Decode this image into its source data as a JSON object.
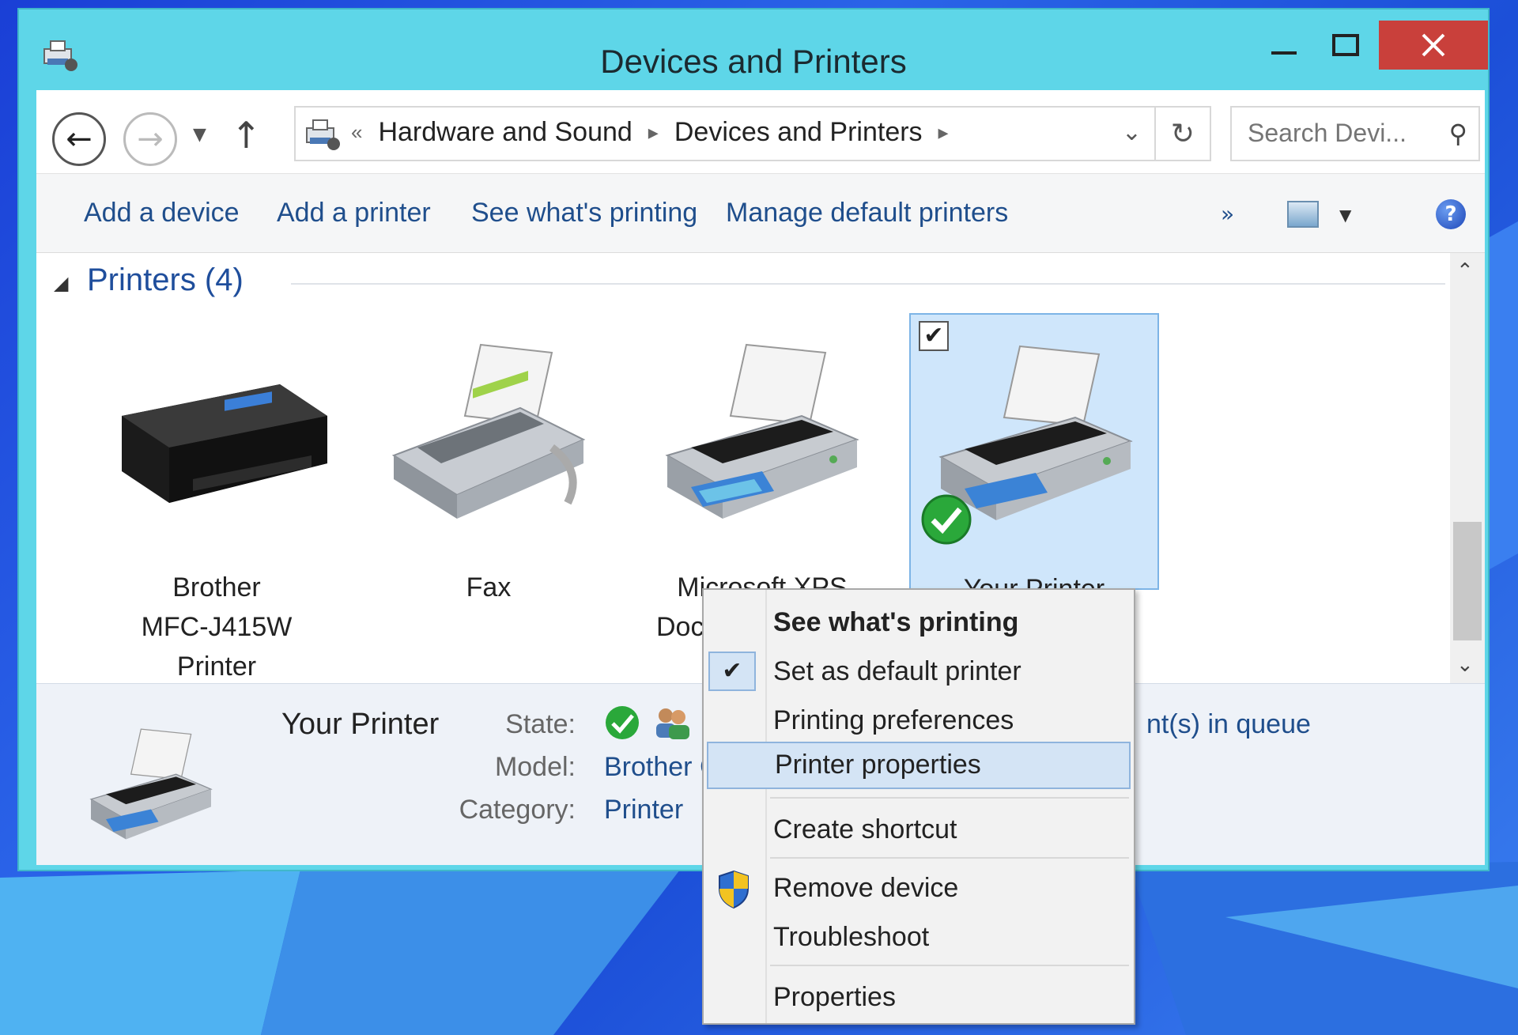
{
  "window": {
    "title": "Devices and Printers"
  },
  "address_bar": {
    "overflow_chevron": "«",
    "crumbs": [
      "Hardware and Sound",
      "Devices and Printers"
    ],
    "search_placeholder": "Search Devi..."
  },
  "command_bar": {
    "add_device": "Add a device",
    "add_printer": "Add a printer",
    "see_printing": "See what's printing",
    "manage_defaults": "Manage default printers",
    "more": "»"
  },
  "group": {
    "label": "Printers (4)"
  },
  "devices": [
    {
      "label_lines": [
        "Brother",
        "MFC-J415W",
        "Printer"
      ],
      "selected": false
    },
    {
      "label_lines": [
        "Fax"
      ],
      "selected": false
    },
    {
      "label_lines": [
        "Microsoft XPS",
        "Docu"
      ],
      "selected": false
    },
    {
      "label_lines": [
        "Your Printer"
      ],
      "selected": true,
      "checked_mark": "✔",
      "default": true
    }
  ],
  "details": {
    "name": "Your Printer",
    "state_label": "State:",
    "model_label": "Model:",
    "category_label": "Category:",
    "model_value": "Brother C",
    "category_value": "Printer",
    "queue_text": "nt(s) in queue"
  },
  "context_menu": {
    "items": [
      {
        "label": "See what's printing",
        "bold": true
      },
      {
        "label": "Set as default printer",
        "checked": true
      },
      {
        "label": "Printing preferences"
      },
      {
        "label": "Printer properties",
        "highlighted": true
      },
      {
        "label": "Create shortcut"
      },
      {
        "label": "Remove device",
        "shield": true
      },
      {
        "label": "Troubleshoot"
      },
      {
        "label": "Properties"
      }
    ]
  },
  "colors": {
    "title_bar": "#5ed6e8",
    "close_button": "#c9403b",
    "link_blue": "#1f4e8c",
    "selection": "#cfe6fb"
  }
}
